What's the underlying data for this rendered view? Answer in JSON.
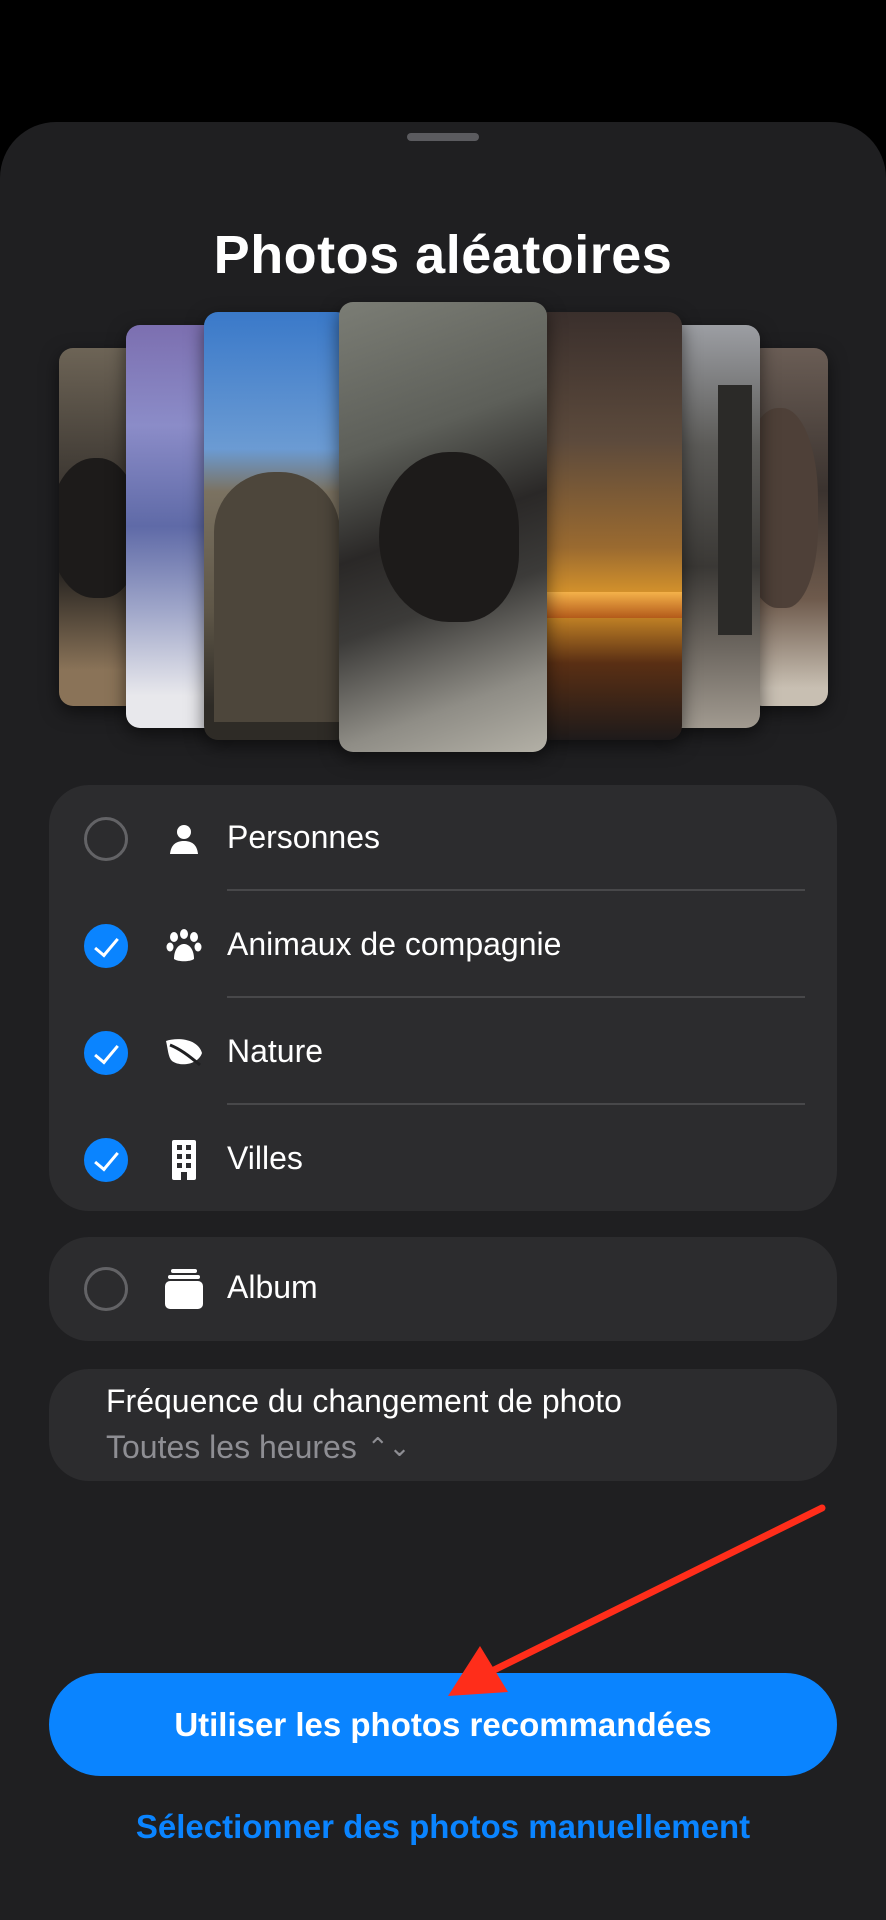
{
  "sheet": {
    "title": "Photos aléatoires"
  },
  "categories": [
    {
      "label": "Personnes",
      "icon": "person-icon",
      "checked": false
    },
    {
      "label": "Animaux de compagnie",
      "icon": "paw-icon",
      "checked": true
    },
    {
      "label": "Nature",
      "icon": "leaf-icon",
      "checked": true
    },
    {
      "label": "Villes",
      "icon": "building-icon",
      "checked": true
    }
  ],
  "album": {
    "label": "Album",
    "icon": "album-stack-icon",
    "checked": false
  },
  "frequency": {
    "title": "Fréquence du changement de photo",
    "value": "Toutes les heures"
  },
  "actions": {
    "primary_label": "Utiliser les photos recommandées",
    "secondary_label": "Sélectionner des photos manuellement"
  },
  "colors": {
    "accent": "#0a84ff",
    "sheet_bg": "#1f1f21",
    "group_bg": "#2c2c2e",
    "annotation_arrow": "#ff2d1a"
  }
}
